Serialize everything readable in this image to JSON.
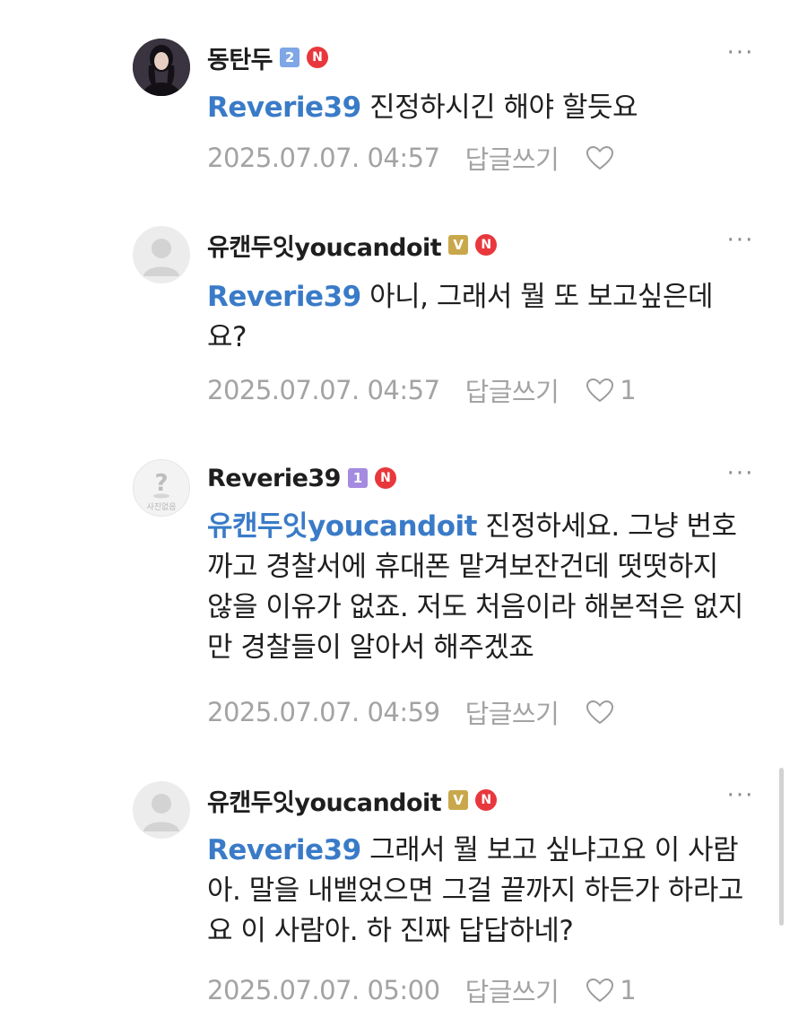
{
  "comments": [
    {
      "author": "동탄두",
      "level_badge": "2",
      "n_badge": "N",
      "more": "···",
      "mention": "Reverie39",
      "text": " 진정하시긴 해야 할듯요",
      "timestamp": "2025.07.07. 04:57",
      "reply_label": "답글쓰기",
      "like_count": ""
    },
    {
      "author": "유캔두잇youcandoit",
      "level_badge": "V",
      "n_badge": "N",
      "more": "···",
      "mention": "Reverie39",
      "text": " 아니, 그래서 뭘 또 보고싶은데요?",
      "timestamp": "2025.07.07. 04:57",
      "reply_label": "답글쓰기",
      "like_count": "1"
    },
    {
      "author": "Reverie39",
      "level_badge": "1",
      "n_badge": "N",
      "more": "···",
      "avatar_text": "사진없음",
      "mention": "유캔두잇youcandoit",
      "text": " 진정하세요. 그냥 번호 까고 경찰서에 휴대폰 맡겨보잔건데 떳떳하지 않을 이유가 없죠. 저도 처음이라 해본적은 없지만 경찰들이 알아서 해주겠죠",
      "timestamp": "2025.07.07. 04:59",
      "reply_label": "답글쓰기",
      "like_count": ""
    },
    {
      "author": "유캔두잇youcandoit",
      "level_badge": "V",
      "n_badge": "N",
      "more": "···",
      "mention": "Reverie39",
      "text": " 그래서 뭘 보고 싶냐고요 이 사람아. 말을 내뱉었으면 그걸 끝까지 하든가 하라고요 이 사람아. 하 진짜 답답하네?",
      "timestamp": "2025.07.07. 05:00",
      "reply_label": "답글쓰기",
      "like_count": "1"
    }
  ],
  "colors": {
    "mention": "#3a7bc8",
    "n_badge": "#e8383d",
    "level_blue": "#7fa6e6",
    "level_gold": "#c9a84c",
    "level_purple": "#a58be0",
    "meta_text": "#a3a3a3"
  },
  "icons": [
    "heart-outline-icon",
    "more-options-icon",
    "default-avatar-icon",
    "question-avatar-icon"
  ]
}
